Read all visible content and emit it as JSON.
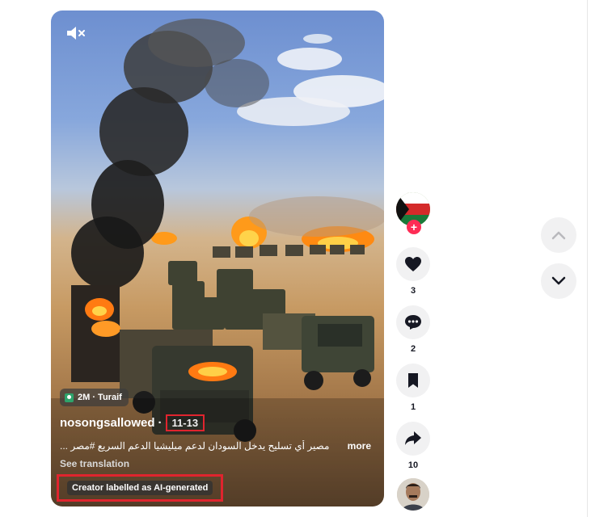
{
  "video": {
    "views_badge": "2M · Turaif",
    "username": "nosongsallowed",
    "separator": "·",
    "date": "11-13",
    "caption": "مصير أي تسليح يدخل السودان لدعم ميليشيا الدعم السريع #مصر ...",
    "more_label": "more",
    "see_translation": "See translation",
    "ai_label": "Creator labelled as AI-generated",
    "icons": {
      "mute": "mute-icon"
    }
  },
  "actions": {
    "like_count": "3",
    "comment_count": "2",
    "bookmark_count": "1",
    "share_count": "10",
    "follow_symbol": "+",
    "icons": [
      "heart-icon",
      "comment-icon",
      "bookmark-icon",
      "share-icon"
    ]
  },
  "navigation": {
    "icons": [
      "chevron-up-icon",
      "chevron-down-icon"
    ]
  },
  "colors": {
    "accent": "#fe2c55",
    "highlight": "#e0242e",
    "button_bg": "#f1f1f2"
  }
}
